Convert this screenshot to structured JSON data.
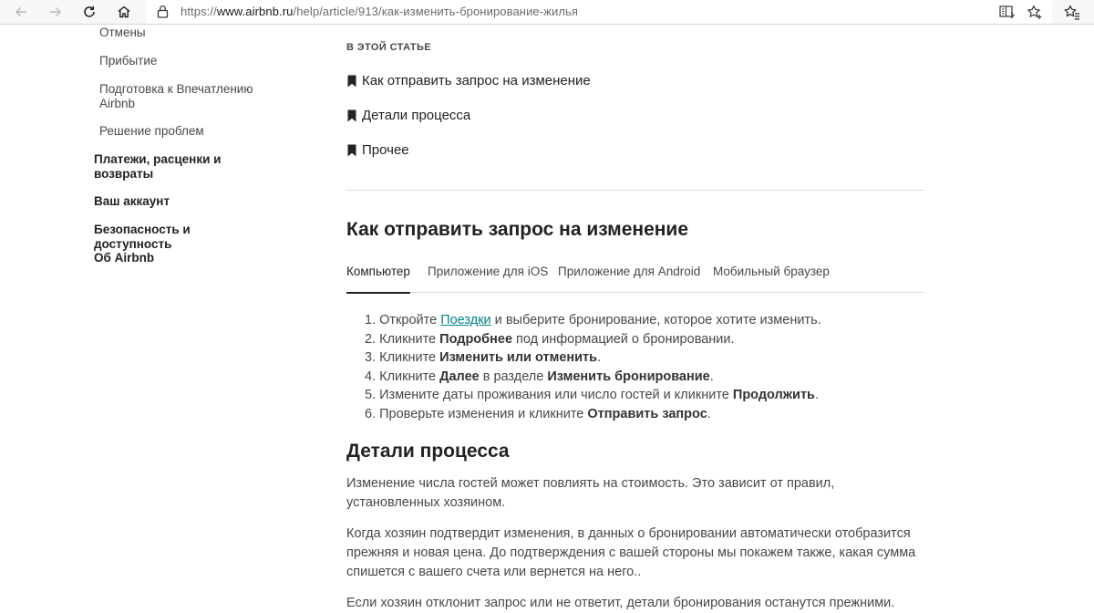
{
  "browser": {
    "url_scheme": "https://",
    "url_host": "www.airbnb.ru",
    "url_path": "/help/article/913/как-изменить-бронирование-жилья",
    "icons": [
      "back-icon",
      "forward-icon",
      "refresh-icon",
      "home-icon",
      "lock-icon",
      "reader-mode-icon",
      "add-favorite-icon",
      "favorites-icon"
    ]
  },
  "sidebar": {
    "sub_items": [
      {
        "label": "Отмены"
      },
      {
        "label": "Прибытие"
      },
      {
        "label": "Подготовка к Впечатлению Airbnb"
      },
      {
        "label": "Решение проблем"
      }
    ],
    "top_items": [
      {
        "label": "Платежи, расценки и возвраты"
      },
      {
        "label": "Ваш аккаунт"
      },
      {
        "label": "Безопасность и доступность"
      },
      {
        "label": "Об Airbnb"
      }
    ]
  },
  "article": {
    "toc_heading": "В ЭТОЙ СТАТЬЕ",
    "toc_links": [
      {
        "label": "Как отправить запрос на изменение"
      },
      {
        "label": "Детали процесса"
      },
      {
        "label": "Прочее"
      }
    ],
    "section1_title": "Как отправить запрос на изменение",
    "tabs": [
      {
        "label": "Компьютер",
        "active": true
      },
      {
        "label": "Приложение для iOS",
        "active": false
      },
      {
        "label": "Приложение для Android",
        "active": false
      },
      {
        "label": "Мобильный браузер",
        "active": false
      }
    ],
    "steps": [
      {
        "num": "1.",
        "t1": "Откройте ",
        "link": "Поездки",
        "t2": " и выберите бронирование, которое хотите изменить."
      },
      {
        "num": "2.",
        "t1": "Кликните ",
        "b1": "Подробнее",
        "t2": " под информацией о бронировании."
      },
      {
        "num": "3.",
        "t1": "Кликните ",
        "b1": "Изменить или отменить",
        "t2": "."
      },
      {
        "num": "4.",
        "t1": "Кликните ",
        "b1": "Далее",
        "t2": " в разделе ",
        "b2": "Изменить бронирование",
        "t3": "."
      },
      {
        "num": "5.",
        "t1": "Измените даты проживания или число гостей и кликните ",
        "b1": "Продолжить",
        "t2": "."
      },
      {
        "num": "6.",
        "t1": "Проверьте изменения и кликните ",
        "b1": "Отправить запрос",
        "t2": "."
      }
    ],
    "section2_title": "Детали процесса",
    "paragraphs": [
      "Изменение числа гостей может повлиять на стоимость. Это зависит от правил, установленных хозяином.",
      "Когда хозяин подтвердит изменения, в данных о бронировании автоматически отобразится прежняя и новая цена. До подтверждения с вашей стороны мы покажем также, какая сумма спишется с вашего счета или вернется на него..",
      "Если хозяин отклонит запрос или не ответит, детали бронирования останутся прежними."
    ],
    "link_color": "#008489"
  }
}
